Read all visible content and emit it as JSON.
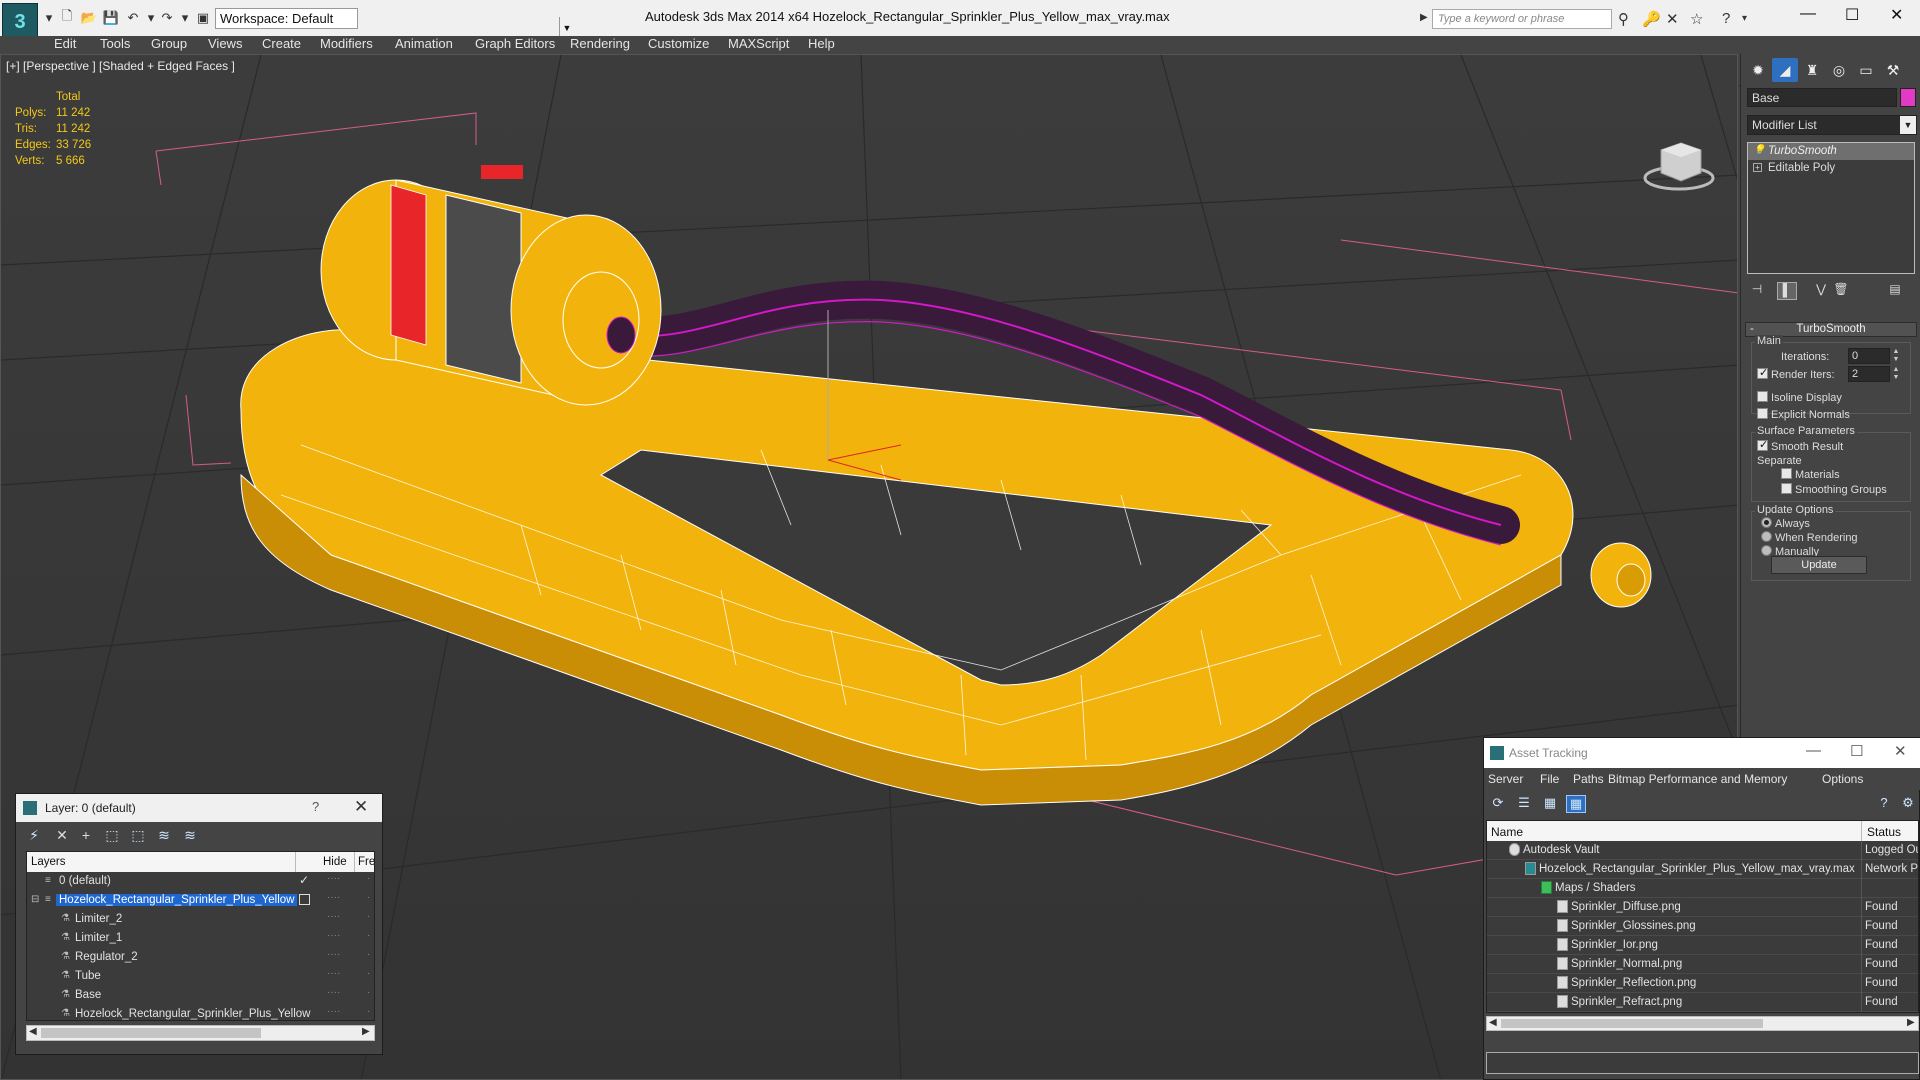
{
  "titlebar": {
    "workspace": "Workspace: Default",
    "title": "Autodesk 3ds Max  2014 x64      Hozelock_Rectangular_Sprinkler_Plus_Yellow_max_vray.max",
    "search_placeholder": "Type a keyword or phrase"
  },
  "menu": [
    "Edit",
    "Tools",
    "Group",
    "Views",
    "Create",
    "Modifiers",
    "Animation",
    "Graph Editors",
    "Rendering",
    "Customize",
    "MAXScript",
    "Help"
  ],
  "viewport": {
    "label": "[+] [Perspective ] [Shaded + Edged Faces ]",
    "stats": {
      "header": "Total",
      "rows": [
        {
          "label": "Polys:",
          "value": "11 242"
        },
        {
          "label": "Tris:",
          "value": "11 242"
        },
        {
          "label": "Edges:",
          "value": "33 726"
        },
        {
          "label": "Verts:",
          "value": "5 666"
        }
      ]
    },
    "colors": {
      "yellow": "#f2b40c",
      "magenta": "#d218c8",
      "grey_band": "#4b4b4b",
      "red": "#e8262a"
    }
  },
  "command_panel": {
    "object_name": "Base",
    "object_color": "#e13bc6",
    "modifier_list": "Modifier List",
    "stack": [
      "TurboSmooth",
      "Editable Poly"
    ],
    "turbosmooth": {
      "title": "TurboSmooth",
      "main": "Main",
      "iterations_label": "Iterations:",
      "iterations": "0",
      "render_iters_label": "Render Iters:",
      "render_iters": "2",
      "isoline": "Isoline Display",
      "explicit": "Explicit Normals",
      "surface": "Surface Parameters",
      "smooth_result": "Smooth Result",
      "separate": "Separate",
      "materials": "Materials",
      "smoothing_groups": "Smoothing Groups",
      "update_options": "Update Options",
      "always": "Always",
      "when_rendering": "When Rendering",
      "manually": "Manually",
      "update": "Update"
    }
  },
  "layer_window": {
    "title": "Layer: 0 (default)",
    "help": "?",
    "columns": {
      "layers": "Layers",
      "hide": "Hide",
      "freeze": "Fre"
    },
    "rows": [
      {
        "name": "0 (default)",
        "indent": 1
      },
      {
        "name": "Hozelock_Rectangular_Sprinkler_Plus_Yellow",
        "indent": 1
      },
      {
        "name": "Limiter_2",
        "indent": 2
      },
      {
        "name": "Limiter_1",
        "indent": 2
      },
      {
        "name": "Regulator_2",
        "indent": 2
      },
      {
        "name": "Tube",
        "indent": 2
      },
      {
        "name": "Base",
        "indent": 2
      },
      {
        "name": "Hozelock_Rectangular_Sprinkler_Plus_Yellow",
        "indent": 2
      }
    ]
  },
  "asset_window": {
    "title": "Asset Tracking",
    "menu": [
      "Server",
      "File",
      "Paths",
      "Bitmap Performance and Memory",
      "Options"
    ],
    "columns": {
      "name": "Name",
      "status": "Status"
    },
    "rows": [
      {
        "name": "Autodesk Vault",
        "status": "Logged Ou",
        "indent": 1
      },
      {
        "name": "Hozelock_Rectangular_Sprinkler_Plus_Yellow_max_vray.max",
        "status": "Network P",
        "indent": 2
      },
      {
        "name": "Maps / Shaders",
        "status": "",
        "indent": 3
      },
      {
        "name": "Sprinkler_Diffuse.png",
        "status": "Found",
        "indent": 4
      },
      {
        "name": "Sprinkler_Glossines.png",
        "status": "Found",
        "indent": 4
      },
      {
        "name": "Sprinkler_Ior.png",
        "status": "Found",
        "indent": 4
      },
      {
        "name": "Sprinkler_Normal.png",
        "status": "Found",
        "indent": 4
      },
      {
        "name": "Sprinkler_Reflection.png",
        "status": "Found",
        "indent": 4
      },
      {
        "name": "Sprinkler_Refract.png",
        "status": "Found",
        "indent": 4
      }
    ]
  }
}
